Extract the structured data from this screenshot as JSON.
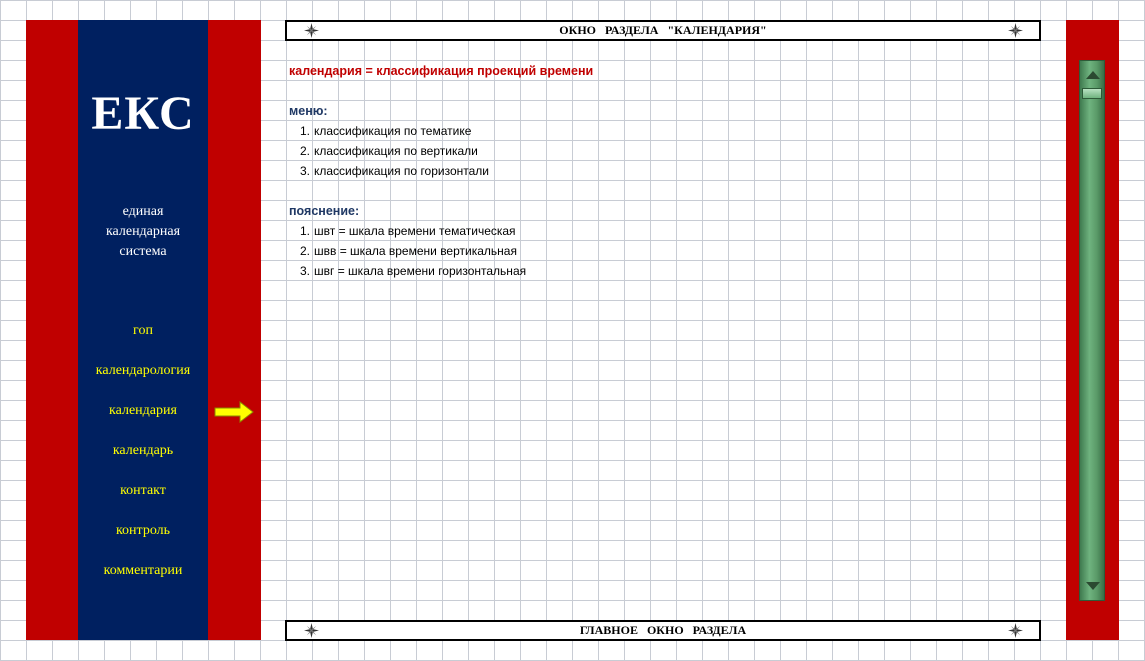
{
  "sidebar": {
    "logo": "ЕКС",
    "subtitle": "единая\nкалендарная\nсистема",
    "nav": [
      {
        "label": "гоп"
      },
      {
        "label": "календарология"
      },
      {
        "label": "календария",
        "active": true
      },
      {
        "label": "календарь"
      },
      {
        "label": "контакт"
      },
      {
        "label": "контроль"
      },
      {
        "label": "комментарии"
      }
    ],
    "active_arrow_icon": "right-arrow-icon"
  },
  "top_bar": {
    "title": "ОКНО   РАЗДЕЛА   \"КАЛЕНДАРИЯ\"",
    "icon": "compass-star-icon"
  },
  "main": {
    "headline": "календария = классификация проекций времени",
    "menu": {
      "title": "меню:",
      "items": [
        {
          "num": "1.",
          "text": "классификация по тематике"
        },
        {
          "num": "2.",
          "text": "классификация по вертикали"
        },
        {
          "num": "3.",
          "text": "классификация по горизонтали"
        }
      ]
    },
    "notes": {
      "title": "пояснение:",
      "items": [
        {
          "num": "1.",
          "text": "швт = шкала времени тематическая"
        },
        {
          "num": "2.",
          "text": "швв = шкала времени вертикальная"
        },
        {
          "num": "3.",
          "text": "швг = шкала времени горизонтальная"
        }
      ]
    }
  },
  "bottom_bar": {
    "title": "ГЛАВНОЕ   ОКНО   РАЗДЕЛА",
    "icon": "compass-star-icon"
  },
  "colors": {
    "sidebar_red": "#c00000",
    "sidebar_navy": "#002060",
    "nav_text": "#ffff00",
    "headline": "#c00000",
    "section_title": "#1f3864",
    "scrollbar": "#5a9a68"
  }
}
